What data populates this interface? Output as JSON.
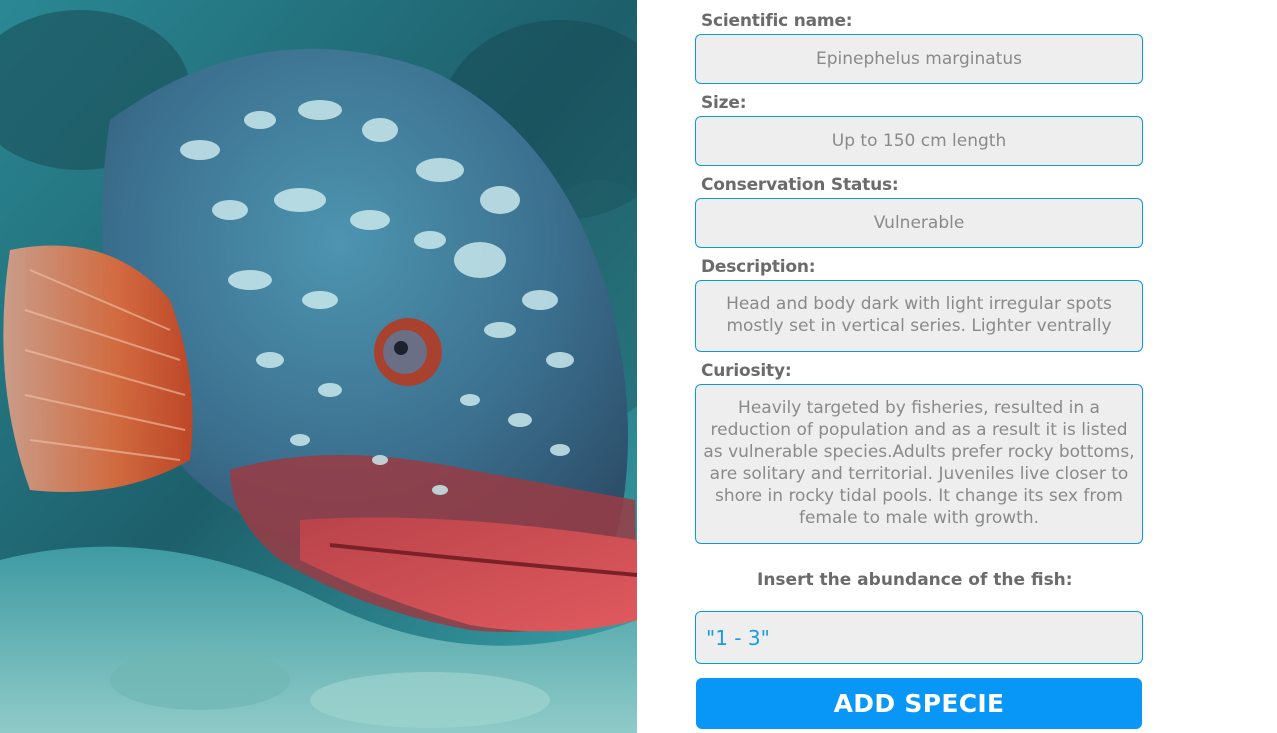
{
  "photo": {
    "alt": "Dusky grouper fish photo"
  },
  "fields": [
    {
      "label": "Scientific name:",
      "value": "Epinephelus marginatus"
    },
    {
      "label": "Size:",
      "value": "Up to 150 cm length"
    },
    {
      "label": "Conservation Status:",
      "value": "Vulnerable"
    },
    {
      "label": "Description:",
      "value": "Head and body dark with light irregular spots mostly set in vertical series.  Lighter ventrally"
    },
    {
      "label": "Curiosity:",
      "value": "Heavily targeted by fisheries, resulted in a reduction of population and as a result it is listed as vulnerable species.Adults prefer rocky bottoms, are solitary and territorial. Juveniles live closer to shore in rocky tidal pools.  It change its sex from female to male with growth."
    }
  ],
  "abundance": {
    "label": "Insert the abundance of the fish:",
    "value": "\"1 - 3\""
  },
  "add_button": {
    "label": "ADD SPECIE"
  },
  "colors": {
    "accent": "#0896f7",
    "border": "#0a9be0",
    "field_bg": "#eeeeee",
    "label_text": "#6b6b6b",
    "value_text": "#8a8a8a"
  }
}
